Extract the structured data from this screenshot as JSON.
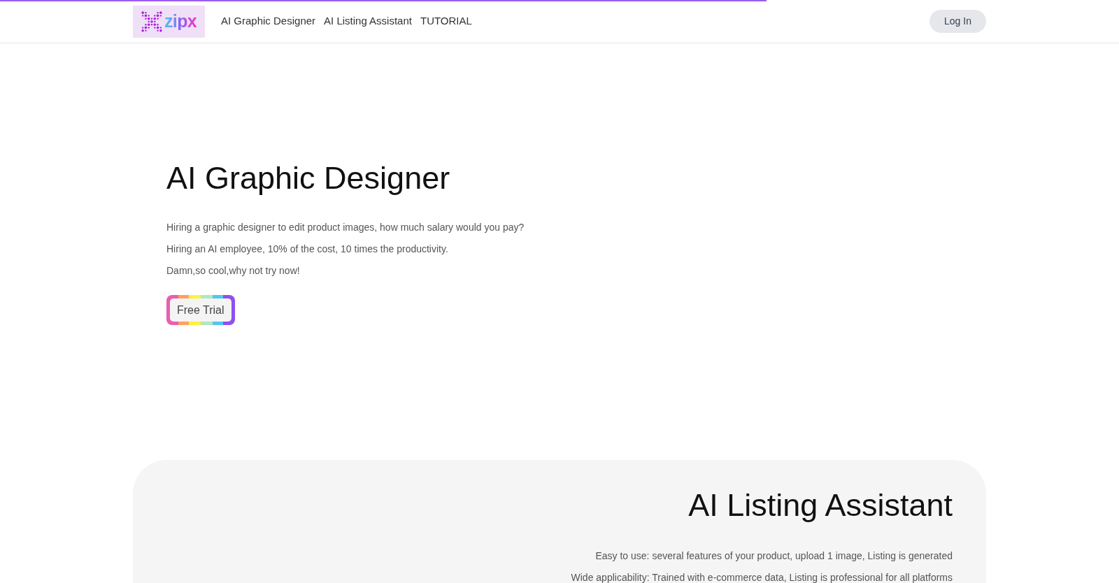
{
  "load_bar": {
    "level": 0.685
  },
  "logo": {
    "text": "zipx"
  },
  "nav": [
    {
      "label": "AI Graphic Designer"
    },
    {
      "label": "AI Listing Assistant"
    },
    {
      "label": "TUTORIAL"
    }
  ],
  "login": {
    "label": "Log In"
  },
  "hero": {
    "title": "AI Graphic Designer",
    "lines": [
      "Hiring a graphic designer to edit product images, how much salary would you pay?",
      "Hiring an AI employee, 10% of the cost, 10 times the productivity.",
      "Damn,so cool,why not try now!"
    ],
    "button": "Free Trial"
  },
  "listing": {
    "title": "AI Listing Assistant",
    "lines": [
      "Easy to use: several features of your product, upload 1 image, Listing is generated",
      "Wide applicability: Trained with e-commerce data, Listing is professional for all platforms"
    ]
  }
}
